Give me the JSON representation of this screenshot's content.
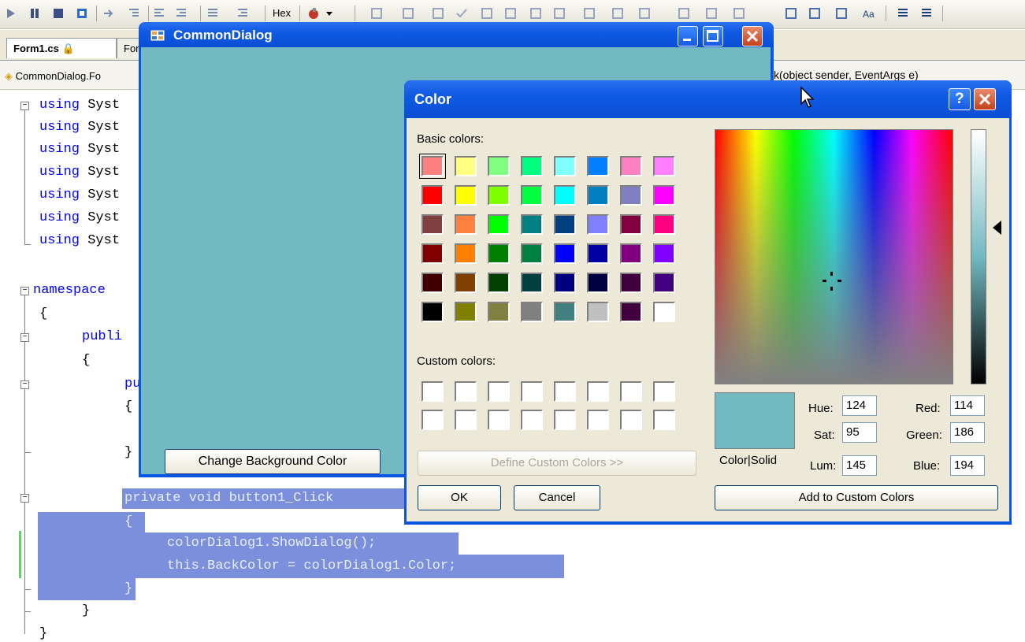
{
  "ide": {
    "toolbar_hex": "Hex",
    "tabs": [
      "Form1.cs",
      "For"
    ],
    "nav_left": "CommonDialog.Fo",
    "nav_right": "k(object sender, EventArgs e)",
    "code": {
      "using": "using",
      "sys": " Syst",
      "namespace": "namespace",
      "public": "publi",
      "pu": "pu",
      "brace_open": "{",
      "brace_close": "}",
      "private_line": "private void button1_Click",
      "show_dialog": "colorDialog1.ShowDialog();",
      "back_color": "this.BackColor = colorDialog1.Color;"
    }
  },
  "common_dialog": {
    "title": "CommonDialog",
    "button": "Change Background Color",
    "back_color": "#72b9c1"
  },
  "color_dialog": {
    "title": "Color",
    "help": "?",
    "basic_colors_label": "Basic colors:",
    "custom_colors_label": "Custom colors:",
    "define_custom": "Define Custom Colors >>",
    "ok": "OK",
    "cancel": "Cancel",
    "add_custom": "Add to Custom Colors",
    "color_solid": "Color|Solid",
    "hue_label": "Hue:",
    "hue": "124",
    "sat_label": "Sat:",
    "sat": "95",
    "lum_label": "Lum:",
    "lum": "145",
    "red_label": "Red:",
    "red": "114",
    "green_label": "Green:",
    "green": "186",
    "blue_label": "Blue:",
    "blue": "194",
    "basic_colors": [
      "#ff8080",
      "#ffff80",
      "#80ff80",
      "#00ff80",
      "#80ffff",
      "#0080ff",
      "#ff80c0",
      "#ff80ff",
      "#ff0000",
      "#ffff00",
      "#80ff00",
      "#00ff40",
      "#00ffff",
      "#0080c0",
      "#8080c0",
      "#ff00ff",
      "#804040",
      "#ff8040",
      "#00ff00",
      "#008080",
      "#004080",
      "#8080ff",
      "#800040",
      "#ff0080",
      "#800000",
      "#ff8000",
      "#008000",
      "#008040",
      "#0000ff",
      "#0000a0",
      "#800080",
      "#8000ff",
      "#400000",
      "#804000",
      "#004000",
      "#004040",
      "#000080",
      "#000040",
      "#400040",
      "#400080",
      "#000000",
      "#808000",
      "#808040",
      "#808080",
      "#408080",
      "#c0c0c0",
      "#400040",
      "#ffffff"
    ]
  }
}
